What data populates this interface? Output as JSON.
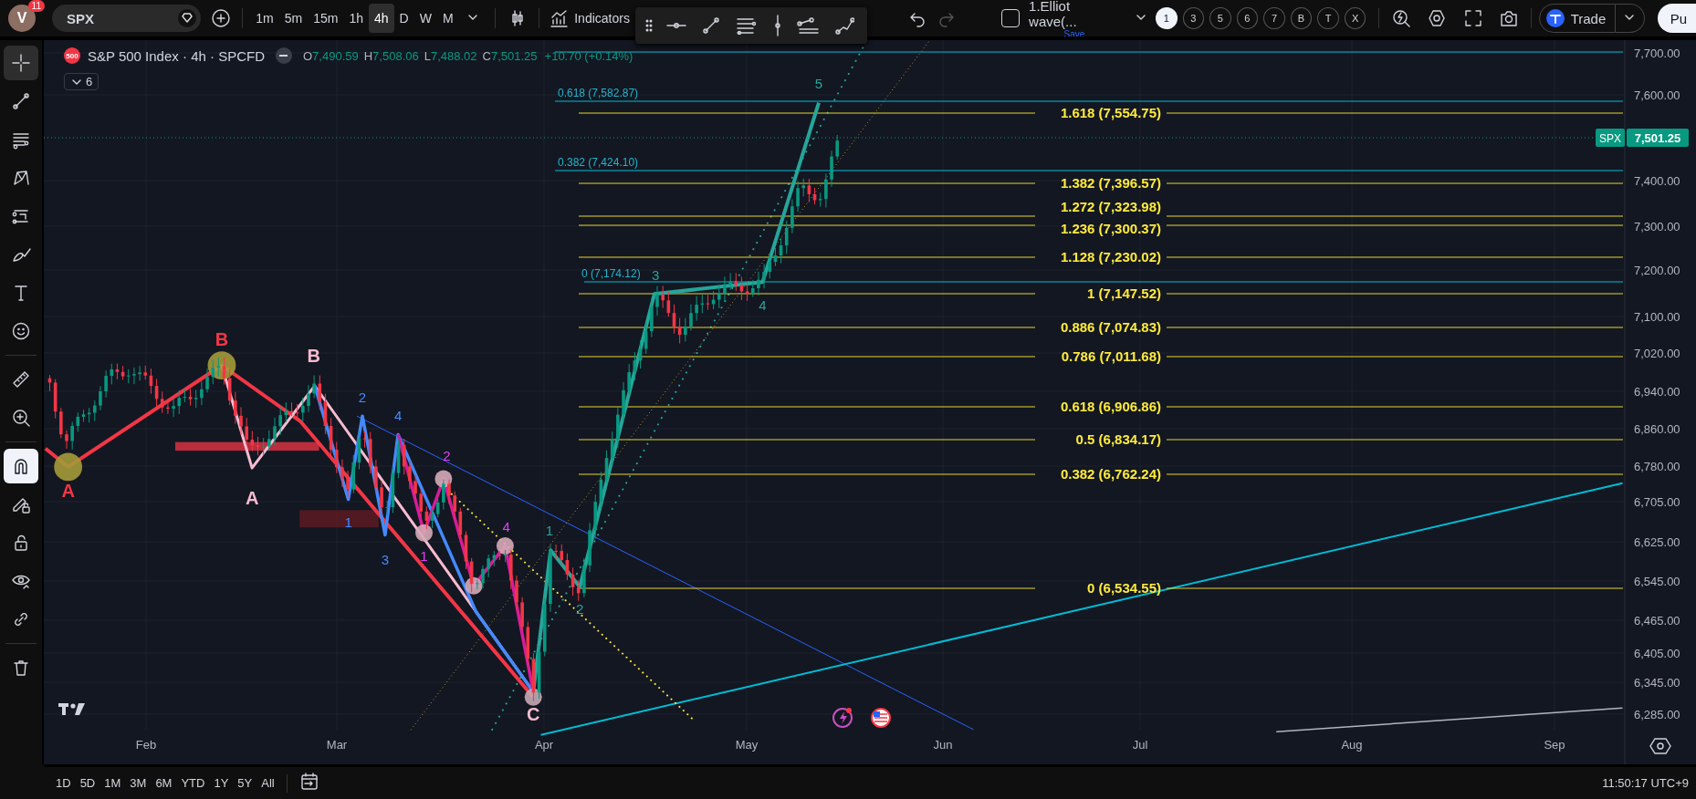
{
  "top_bar": {
    "avatar": "V",
    "notification_count": "11",
    "symbol": "SPX",
    "intervals": [
      {
        "label": "1m",
        "selected": false
      },
      {
        "label": "5m",
        "selected": false
      },
      {
        "label": "15m",
        "selected": false
      },
      {
        "label": "1h",
        "selected": false
      },
      {
        "label": "4h",
        "selected": true
      },
      {
        "label": "D",
        "selected": false
      },
      {
        "label": "W",
        "selected": false
      },
      {
        "label": "M",
        "selected": false
      }
    ],
    "indicators": "Indicators",
    "layout_checkbox": {
      "checked": false
    },
    "layout_name": "1.Elliot wave(...",
    "layout_save": "Save",
    "layout_tabs": [
      {
        "label": "1",
        "selected": true
      },
      {
        "label": "3",
        "selected": false
      },
      {
        "label": "5",
        "selected": false
      },
      {
        "label": "6",
        "selected": false
      },
      {
        "label": "7",
        "selected": false
      },
      {
        "label": "B",
        "selected": false
      },
      {
        "label": "T",
        "selected": false
      },
      {
        "label": "X",
        "selected": false
      }
    ],
    "trade_button": "Trade",
    "publish_button": "Pu"
  },
  "left_toolbar": {
    "tools": [
      {
        "kind": "crosshair",
        "active": true
      },
      {
        "kind": "trendline",
        "active": false
      },
      {
        "kind": "fib",
        "active": false
      },
      {
        "kind": "pattern",
        "active": false
      },
      {
        "kind": "projection",
        "active": false
      },
      {
        "kind": "brush",
        "active": false
      },
      {
        "kind": "text",
        "active": false
      },
      {
        "kind": "emoji",
        "active": false
      },
      {
        "kind": "ruler",
        "active": false
      },
      {
        "kind": "zoom",
        "active": false
      },
      {
        "kind": "magnet",
        "active": true
      },
      {
        "kind": "drawlock",
        "active": false
      },
      {
        "kind": "lock",
        "active": false
      },
      {
        "kind": "eye",
        "active": false
      },
      {
        "kind": "link",
        "active": false
      },
      {
        "kind": "trash",
        "active": false
      }
    ]
  },
  "legend": {
    "badge": "500",
    "title": "S&P 500 Index · 4h · SPCFD",
    "ohlc": [
      {
        "key": "O",
        "value": "7,490.59"
      },
      {
        "key": "H",
        "value": "7,508.06"
      },
      {
        "key": "L",
        "value": "7,488.02"
      },
      {
        "key": "C",
        "value": "7,501.25"
      }
    ],
    "change": "+10.70 (+0.14%)",
    "indicator_count": "6"
  },
  "chart": {
    "wave_labels": [
      {
        "text": "A",
        "color": "#f23645"
      },
      {
        "text": "B",
        "color": "#f23645"
      },
      {
        "text": "B",
        "color": "#f8bbd0"
      },
      {
        "text": "A",
        "color": "#f8bbd0"
      },
      {
        "text": "C",
        "color": "#f8bbd0"
      },
      {
        "text": "1",
        "color": "#448aff"
      },
      {
        "text": "2",
        "color": "#448aff"
      },
      {
        "text": "3",
        "color": "#448aff"
      },
      {
        "text": "4",
        "color": "#448aff"
      },
      {
        "text": "1",
        "color": "#e040fb"
      },
      {
        "text": "2",
        "color": "#e040fb"
      },
      {
        "text": "4",
        "color": "#e040fb"
      },
      {
        "text": "1",
        "color": "#26a69a"
      },
      {
        "text": "2",
        "color": "#26a69a"
      },
      {
        "text": "3",
        "color": "#26a69a"
      },
      {
        "text": "4",
        "color": "#26a69a"
      },
      {
        "text": "5",
        "color": "#26a69a"
      }
    ],
    "fib_levels": [
      "1.618 (7,554.75)",
      "1.382 (7,396.57)",
      "1.272 (7,323.98)",
      "1.236 (7,300.37)",
      "1.128 (7,230.02)",
      "1 (7,147.52)",
      "0.886 (7,074.83)",
      "0.786 (7,011.68)",
      "0.618 (6,906.86)",
      "0.5 (6,834.17)",
      "0.382 (6,762.24)",
      "0 (6,534.55)"
    ],
    "fib_extension_levels": [
      "0.618 (7,582.87)",
      "0.382 (7,424.10)",
      "0 (7,174.12)"
    ],
    "price_axis": [
      "7,700.00",
      "7,600.00",
      "7,400.00",
      "7,300.00",
      "7,200.00",
      "7,100.00",
      "7,020.00",
      "6,940.00",
      "6,860.00",
      "6,780.00",
      "6,705.00",
      "6,625.00",
      "6,545.00",
      "6,465.00",
      "6,405.00",
      "6,345.00",
      "6,285.00"
    ],
    "last_price": {
      "symbol": "SPX",
      "value": "7,501.25"
    },
    "time_axis": [
      "Feb",
      "Mar",
      "Apr",
      "May",
      "Jun",
      "Jul",
      "Aug",
      "Sep"
    ]
  },
  "bottom_bar": {
    "ranges": [
      "1D",
      "5D",
      "1M",
      "3M",
      "6M",
      "YTD",
      "1Y",
      "5Y",
      "All"
    ],
    "clock": "11:50:17 UTC+9"
  }
}
